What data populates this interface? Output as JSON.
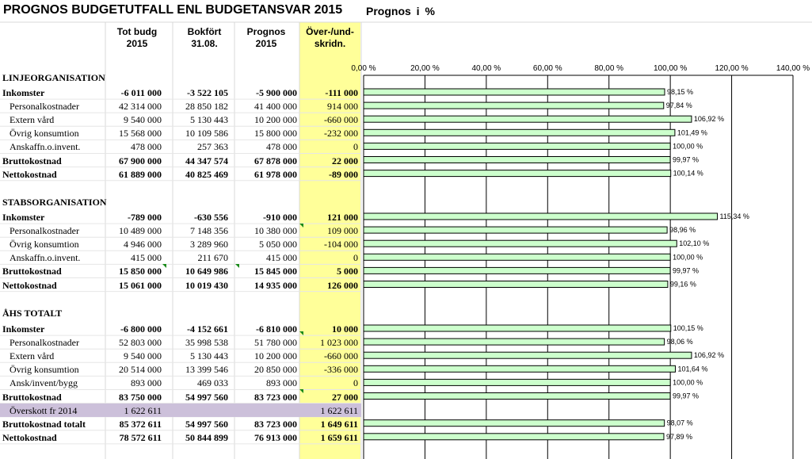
{
  "title": "PROGNOS BUDGETUTFALL  ENL BUDGETANSVAR 2015",
  "subtitle": "Prognos  i  %",
  "headers": {
    "col1": [
      "Tot budg",
      "2015"
    ],
    "col2": [
      "Bokfört",
      "31.08."
    ],
    "col3": [
      "Prognos",
      "2015"
    ],
    "col4": [
      "Över-/und-",
      "skridn."
    ]
  },
  "sections": [
    {
      "title": "LINJEORGANISATION",
      "rows": [
        {
          "label": "Inkomster",
          "bold": true,
          "indent": false,
          "values": [
            "-6 011 000",
            "-3 522 105",
            "-5 900 000",
            "-111 000"
          ]
        },
        {
          "label": "Personalkostnader",
          "bold": false,
          "indent": true,
          "values": [
            "42 314 000",
            "28 850 182",
            "41 400 000",
            "914 000"
          ]
        },
        {
          "label": "Extern vård",
          "bold": false,
          "indent": true,
          "values": [
            "9 540 000",
            "5 130 443",
            "10 200 000",
            "-660 000"
          ]
        },
        {
          "label": "Övrig konsumtion",
          "bold": false,
          "indent": true,
          "values": [
            "15 568 000",
            "10 109 586",
            "15 800 000",
            "-232 000"
          ]
        },
        {
          "label": "Anskaffn.o.invent.",
          "bold": false,
          "indent": true,
          "values": [
            "478 000",
            "257 363",
            "478 000",
            "0"
          ]
        },
        {
          "label": "Bruttokostnad",
          "bold": true,
          "indent": false,
          "values": [
            "67 900 000",
            "44 347 574",
            "67 878 000",
            "22 000"
          ]
        },
        {
          "label": "Nettokostnad",
          "bold": true,
          "indent": false,
          "values": [
            "61 889 000",
            "40 825 469",
            "61 978 000",
            "-89 000"
          ]
        }
      ]
    },
    {
      "title": "STABSORGANISATION",
      "rows": [
        {
          "label": "Inkomster",
          "bold": true,
          "indent": false,
          "values": [
            "-789 000",
            "-630 556",
            "-910 000",
            "121 000"
          ]
        },
        {
          "label": "Personalkostnader",
          "bold": false,
          "indent": true,
          "values": [
            "10 489 000",
            "7 148 356",
            "10 380 000",
            "109 000"
          ]
        },
        {
          "label": "Övrig konsumtion",
          "bold": false,
          "indent": true,
          "values": [
            "4 946 000",
            "3 289 960",
            "5 050 000",
            "-104 000"
          ]
        },
        {
          "label": "Anskaffn.o.invent.",
          "bold": false,
          "indent": true,
          "values": [
            "415 000",
            "211 670",
            "415 000",
            "0"
          ]
        },
        {
          "label": "Bruttokostnad",
          "bold": true,
          "indent": false,
          "values": [
            "15 850 000",
            "10 649 986",
            "15 845 000",
            "5 000"
          ]
        },
        {
          "label": "Nettokostnad",
          "bold": true,
          "indent": false,
          "values": [
            "15 061 000",
            "10 019 430",
            "14 935 000",
            "126 000"
          ]
        }
      ]
    },
    {
      "title": "ÅHS TOTALT",
      "rows": [
        {
          "label": "Inkomster",
          "bold": true,
          "indent": false,
          "values": [
            "-6 800 000",
            "-4 152 661",
            "-6 810 000",
            "10 000"
          ]
        },
        {
          "label": "Personalkostnader",
          "bold": false,
          "indent": true,
          "values": [
            "52 803 000",
            "35 998 538",
            "51 780 000",
            "1 023 000"
          ]
        },
        {
          "label": "Extern vård",
          "bold": false,
          "indent": true,
          "values": [
            "9 540 000",
            "5 130 443",
            "10 200 000",
            "-660 000"
          ]
        },
        {
          "label": "Övrig konsumtion",
          "bold": false,
          "indent": true,
          "values": [
            "20 514 000",
            "13 399 546",
            "20 850 000",
            "-336 000"
          ]
        },
        {
          "label": "Ansk/invent/bygg",
          "bold": false,
          "indent": true,
          "values": [
            "893 000",
            "469 033",
            "893 000",
            "0"
          ]
        },
        {
          "label": "Bruttokostnad",
          "bold": true,
          "indent": false,
          "values": [
            "83 750 000",
            "54 997 560",
            "83 723 000",
            "27 000"
          ]
        },
        {
          "label": "Överskott fr 2014",
          "bold": false,
          "indent": true,
          "highlight": true,
          "values": [
            "1 622 611",
            "",
            "",
            "1 622 611"
          ]
        },
        {
          "label": "Bruttokostnad totalt",
          "bold": true,
          "indent": false,
          "values": [
            "85 372 611",
            "54 997 560",
            "83 723 000",
            "1 649 611"
          ]
        },
        {
          "label": "Nettokostnad",
          "bold": true,
          "indent": false,
          "values": [
            "78 572 611",
            "50 844 899",
            "76 913 000",
            "1 659 611"
          ]
        }
      ]
    }
  ],
  "colors": {
    "bar_fill": "#ccffcc",
    "bar_stroke": "#000000",
    "highlight_row": "#ccc0da",
    "variance_column": "#ffff99"
  },
  "chart_data": {
    "type": "bar",
    "orientation": "horizontal",
    "title": "Prognos  i  %",
    "xlim": [
      0,
      140
    ],
    "x_ticks": [
      "0,00 %",
      "20,00 %",
      "40,00 %",
      "60,00 %",
      "80,00 %",
      "100,00 %",
      "120,00 %",
      "140,00 %"
    ],
    "grid": true,
    "sections": [
      {
        "values": [
          98.15,
          97.84,
          106.92,
          101.49,
          100.0,
          99.97,
          100.14
        ],
        "labels": [
          "98,15 %",
          "97,84 %",
          "106,92 %",
          "101,49 %",
          "100,00 %",
          "99,97 %",
          "100,14 %"
        ]
      },
      {
        "values": [
          115.34,
          98.96,
          102.1,
          100.0,
          99.97,
          99.16
        ],
        "labels": [
          "115,34 %",
          "98,96 %",
          "102,10 %",
          "100,00 %",
          "99,97 %",
          "99,16 %"
        ]
      },
      {
        "values": [
          100.15,
          98.06,
          106.92,
          101.64,
          100.0,
          99.97,
          null,
          98.07,
          97.89
        ],
        "labels": [
          "100,15 %",
          "98,06 %",
          "106,92 %",
          "101,64 %",
          "100,00 %",
          "99,97 %",
          "",
          "98,07 %",
          "97,89 %"
        ]
      }
    ]
  }
}
